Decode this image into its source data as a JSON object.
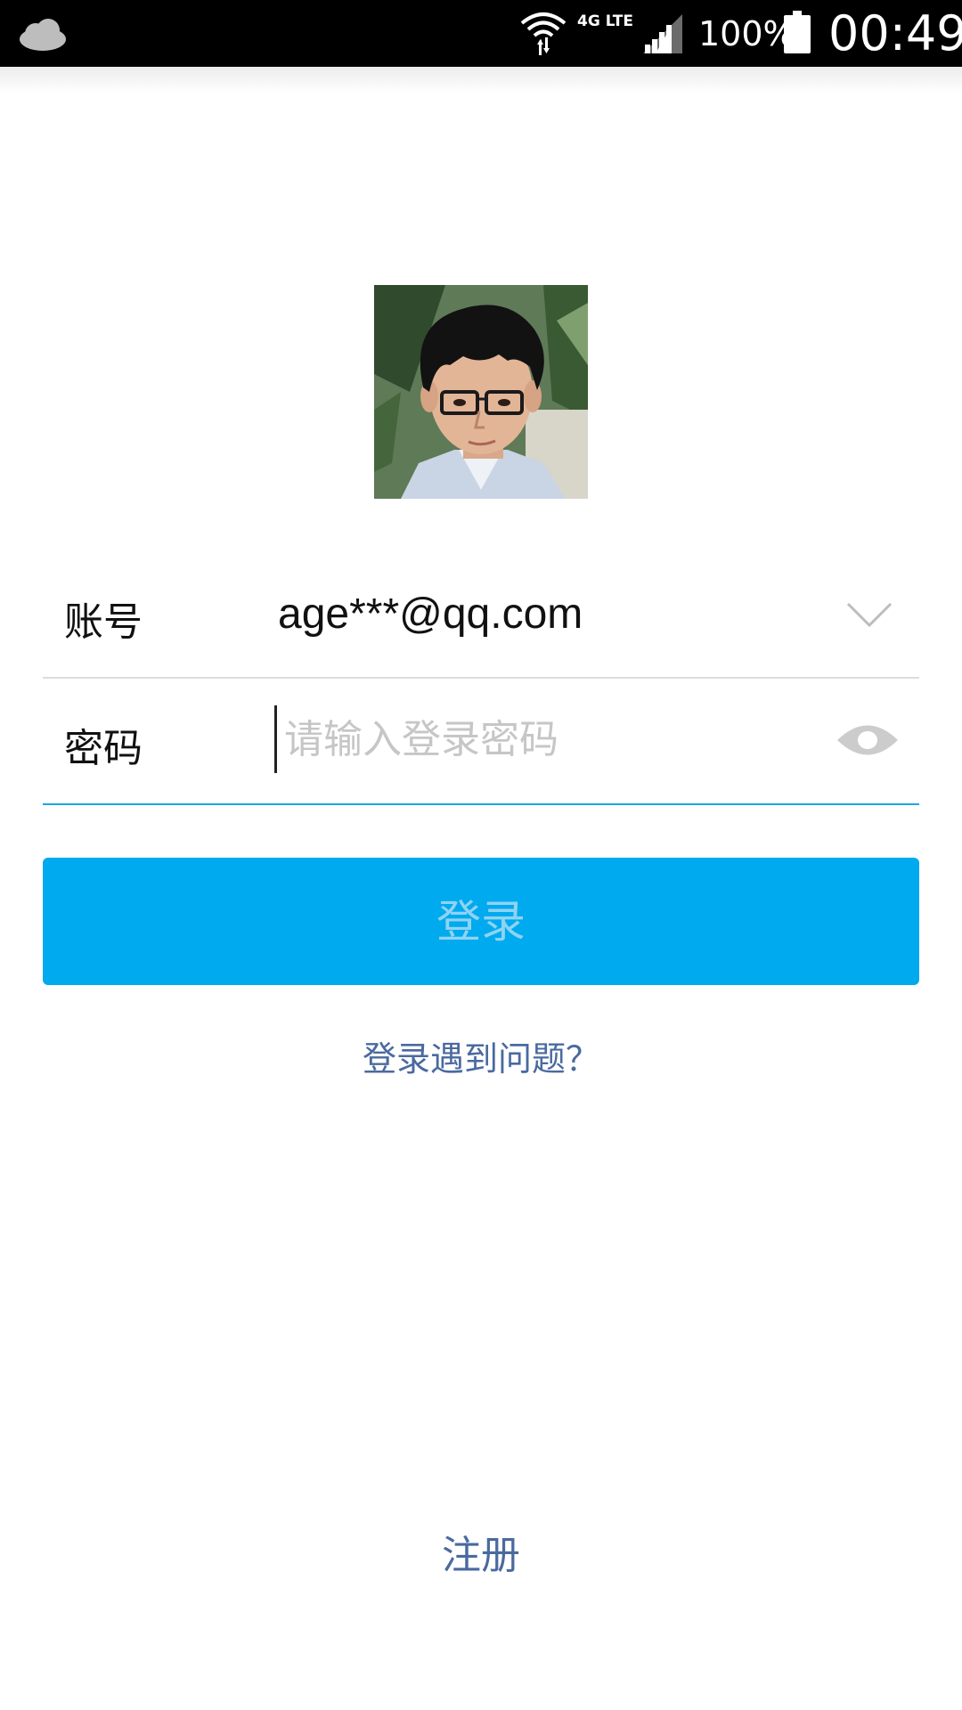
{
  "status_bar": {
    "network_type": "4G LTE",
    "battery_percent": "100%",
    "time": "00:49"
  },
  "icons": {
    "cloud": "cloud-icon",
    "wifi": "wifi-icon",
    "signal": "signal-icon",
    "battery": "battery-icon",
    "chevron": "chevron-down-icon",
    "eye": "eye-icon"
  },
  "login_form": {
    "account_label": "账号",
    "account_value": "age***@qq.com",
    "password_label": "密码",
    "password_placeholder": "请输入登录密码",
    "password_value": "",
    "login_button": "登录",
    "trouble_link": "登录遇到问题？",
    "register_link": "注册"
  },
  "colors": {
    "accent": "#00aaef",
    "link": "#4a6a9f",
    "active_underline": "#1ba7e3"
  }
}
